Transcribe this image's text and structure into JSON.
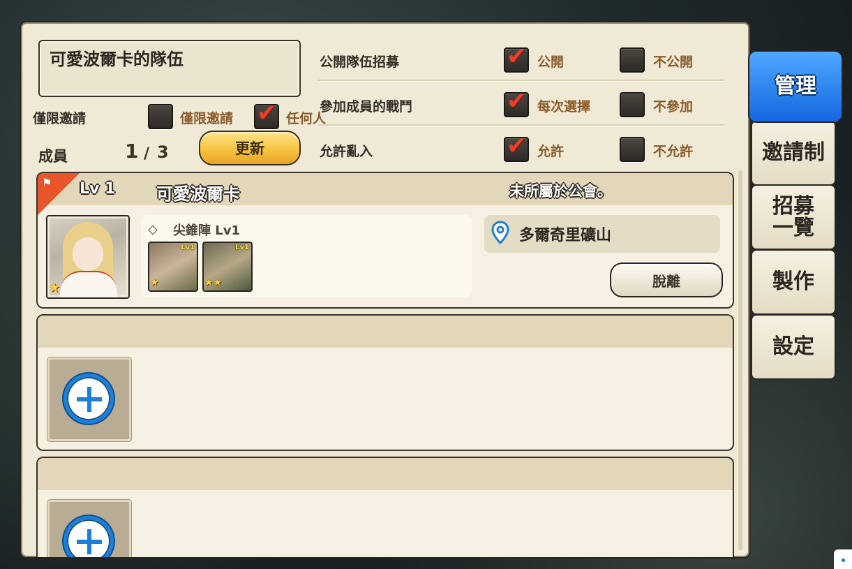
{
  "party": {
    "name": "可愛波爾卡的隊伍",
    "invite_label": "僅限邀請",
    "invite_options": [
      {
        "label": "僅限邀請",
        "checked": false
      },
      {
        "label": "任何人",
        "checked": true
      }
    ],
    "members_label": "成員",
    "members_current": "1",
    "members_sep": "/",
    "members_max": "3",
    "update_button": "更新"
  },
  "settings": [
    {
      "label": "公開隊伍招募",
      "opt1": "公開",
      "opt1_checked": true,
      "opt2": "不公開",
      "opt2_checked": false
    },
    {
      "label": "參加成員的戰鬥",
      "opt1": "每次選擇",
      "opt1_checked": true,
      "opt2": "不參加",
      "opt2_checked": false
    },
    {
      "label": "允許亂入",
      "opt1": "允許",
      "opt1_checked": true,
      "opt2": "不允許",
      "opt2_checked": false
    }
  ],
  "member": {
    "level": "Lv 1",
    "name": "可愛波爾卡",
    "guild_status": "未所屬於公會。",
    "portrait_stars": 1,
    "formation": "尖錐陣 Lv1",
    "companions": [
      {
        "level_tag": "Lv1",
        "stars": 1
      },
      {
        "level_tag": "Lv1",
        "stars": 2
      }
    ],
    "location": "多爾奇里礦山",
    "leave_button": "脫離"
  },
  "tabs": [
    {
      "label": "管理",
      "active": true
    },
    {
      "label": "邀請制",
      "active": false
    },
    {
      "label": "招募一覽",
      "line1": "招募",
      "line2": "一覽",
      "active": false
    },
    {
      "label": "製作",
      "active": false
    },
    {
      "label": "設定",
      "active": false
    }
  ],
  "colors": {
    "panel": "#efe9d6",
    "accent_orange": "#e8552a",
    "check_red": "#e8402a",
    "tab_active_blue": "#1466e0",
    "button_yellow": "#f6c341",
    "add_blue": "#1d7fd6"
  },
  "icons": {
    "check": "check-icon",
    "flag": "leader-flag-icon",
    "location": "location-pin-icon",
    "formation": "formation-icon",
    "add": "plus-circle-icon",
    "star": "star-icon"
  }
}
